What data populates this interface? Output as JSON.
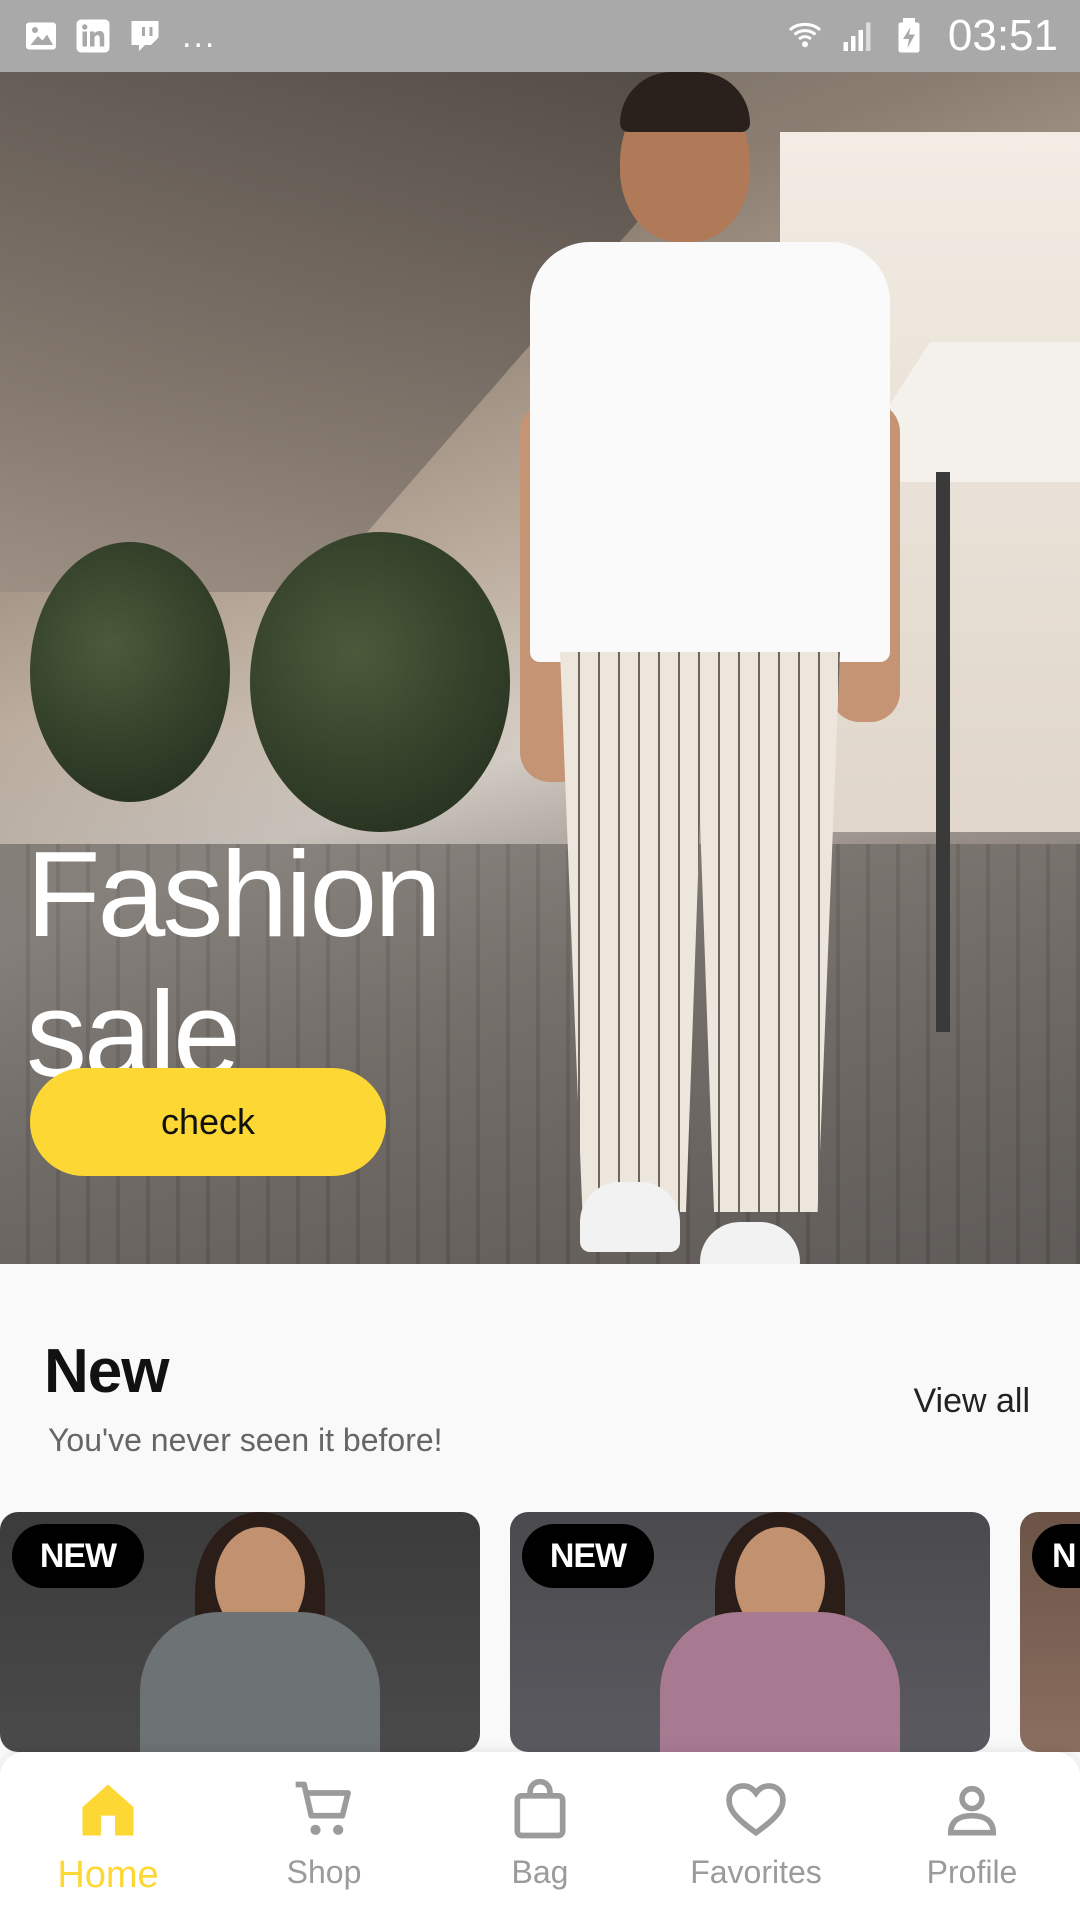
{
  "status_bar": {
    "left_icons": [
      "image-icon",
      "linkedin-icon",
      "twitch-icon"
    ],
    "more": "...",
    "right_icons": [
      "wifi-icon",
      "signal-icon",
      "battery-charging-icon"
    ],
    "time": "03:51"
  },
  "hero": {
    "title_line1": "Fashion",
    "title_line2": "sale",
    "button_label": "check"
  },
  "new_section": {
    "title": "New",
    "subtitle": "You've never seen it before!",
    "view_all": "View all",
    "cards": [
      {
        "badge": "NEW"
      },
      {
        "badge": "NEW"
      },
      {
        "badge": "N"
      }
    ]
  },
  "bottom_nav": {
    "items": [
      {
        "label": "Home",
        "icon": "home-icon",
        "active": true
      },
      {
        "label": "Shop",
        "icon": "cart-icon",
        "active": false
      },
      {
        "label": "Bag",
        "icon": "bag-icon",
        "active": false
      },
      {
        "label": "Favorites",
        "icon": "heart-icon",
        "active": false
      },
      {
        "label": "Profile",
        "icon": "person-icon",
        "active": false
      }
    ]
  },
  "colors": {
    "accent": "#fdd835",
    "status_bar": "#a9a9a9",
    "badge_bg": "#000000",
    "nav_inactive": "#9b9b9b"
  }
}
